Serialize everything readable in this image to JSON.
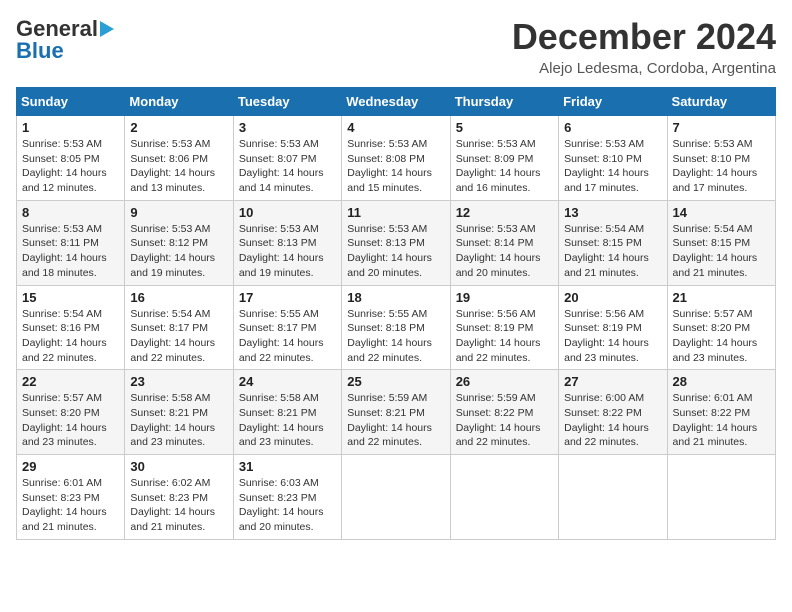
{
  "header": {
    "logo_line1": "General",
    "logo_line2": "Blue",
    "month": "December 2024",
    "location": "Alejo Ledesma, Cordoba, Argentina"
  },
  "days_of_week": [
    "Sunday",
    "Monday",
    "Tuesday",
    "Wednesday",
    "Thursday",
    "Friday",
    "Saturday"
  ],
  "weeks": [
    [
      {
        "day": "1",
        "sunrise": "5:53 AM",
        "sunset": "8:05 PM",
        "daylight": "14 hours and 12 minutes."
      },
      {
        "day": "2",
        "sunrise": "5:53 AM",
        "sunset": "8:06 PM",
        "daylight": "14 hours and 13 minutes."
      },
      {
        "day": "3",
        "sunrise": "5:53 AM",
        "sunset": "8:07 PM",
        "daylight": "14 hours and 14 minutes."
      },
      {
        "day": "4",
        "sunrise": "5:53 AM",
        "sunset": "8:08 PM",
        "daylight": "14 hours and 15 minutes."
      },
      {
        "day": "5",
        "sunrise": "5:53 AM",
        "sunset": "8:09 PM",
        "daylight": "14 hours and 16 minutes."
      },
      {
        "day": "6",
        "sunrise": "5:53 AM",
        "sunset": "8:10 PM",
        "daylight": "14 hours and 17 minutes."
      },
      {
        "day": "7",
        "sunrise": "5:53 AM",
        "sunset": "8:10 PM",
        "daylight": "14 hours and 17 minutes."
      }
    ],
    [
      {
        "day": "8",
        "sunrise": "5:53 AM",
        "sunset": "8:11 PM",
        "daylight": "14 hours and 18 minutes."
      },
      {
        "day": "9",
        "sunrise": "5:53 AM",
        "sunset": "8:12 PM",
        "daylight": "14 hours and 19 minutes."
      },
      {
        "day": "10",
        "sunrise": "5:53 AM",
        "sunset": "8:13 PM",
        "daylight": "14 hours and 19 minutes."
      },
      {
        "day": "11",
        "sunrise": "5:53 AM",
        "sunset": "8:13 PM",
        "daylight": "14 hours and 20 minutes."
      },
      {
        "day": "12",
        "sunrise": "5:53 AM",
        "sunset": "8:14 PM",
        "daylight": "14 hours and 20 minutes."
      },
      {
        "day": "13",
        "sunrise": "5:54 AM",
        "sunset": "8:15 PM",
        "daylight": "14 hours and 21 minutes."
      },
      {
        "day": "14",
        "sunrise": "5:54 AM",
        "sunset": "8:15 PM",
        "daylight": "14 hours and 21 minutes."
      }
    ],
    [
      {
        "day": "15",
        "sunrise": "5:54 AM",
        "sunset": "8:16 PM",
        "daylight": "14 hours and 22 minutes."
      },
      {
        "day": "16",
        "sunrise": "5:54 AM",
        "sunset": "8:17 PM",
        "daylight": "14 hours and 22 minutes."
      },
      {
        "day": "17",
        "sunrise": "5:55 AM",
        "sunset": "8:17 PM",
        "daylight": "14 hours and 22 minutes."
      },
      {
        "day": "18",
        "sunrise": "5:55 AM",
        "sunset": "8:18 PM",
        "daylight": "14 hours and 22 minutes."
      },
      {
        "day": "19",
        "sunrise": "5:56 AM",
        "sunset": "8:19 PM",
        "daylight": "14 hours and 22 minutes."
      },
      {
        "day": "20",
        "sunrise": "5:56 AM",
        "sunset": "8:19 PM",
        "daylight": "14 hours and 23 minutes."
      },
      {
        "day": "21",
        "sunrise": "5:57 AM",
        "sunset": "8:20 PM",
        "daylight": "14 hours and 23 minutes."
      }
    ],
    [
      {
        "day": "22",
        "sunrise": "5:57 AM",
        "sunset": "8:20 PM",
        "daylight": "14 hours and 23 minutes."
      },
      {
        "day": "23",
        "sunrise": "5:58 AM",
        "sunset": "8:21 PM",
        "daylight": "14 hours and 23 minutes."
      },
      {
        "day": "24",
        "sunrise": "5:58 AM",
        "sunset": "8:21 PM",
        "daylight": "14 hours and 23 minutes."
      },
      {
        "day": "25",
        "sunrise": "5:59 AM",
        "sunset": "8:21 PM",
        "daylight": "14 hours and 22 minutes."
      },
      {
        "day": "26",
        "sunrise": "5:59 AM",
        "sunset": "8:22 PM",
        "daylight": "14 hours and 22 minutes."
      },
      {
        "day": "27",
        "sunrise": "6:00 AM",
        "sunset": "8:22 PM",
        "daylight": "14 hours and 22 minutes."
      },
      {
        "day": "28",
        "sunrise": "6:01 AM",
        "sunset": "8:22 PM",
        "daylight": "14 hours and 21 minutes."
      }
    ],
    [
      {
        "day": "29",
        "sunrise": "6:01 AM",
        "sunset": "8:23 PM",
        "daylight": "14 hours and 21 minutes."
      },
      {
        "day": "30",
        "sunrise": "6:02 AM",
        "sunset": "8:23 PM",
        "daylight": "14 hours and 21 minutes."
      },
      {
        "day": "31",
        "sunrise": "6:03 AM",
        "sunset": "8:23 PM",
        "daylight": "14 hours and 20 minutes."
      },
      null,
      null,
      null,
      null
    ]
  ],
  "labels": {
    "sunrise": "Sunrise:",
    "sunset": "Sunset:",
    "daylight": "Daylight:"
  }
}
